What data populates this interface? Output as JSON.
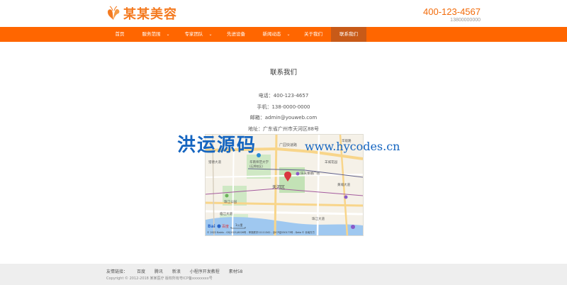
{
  "brand": {
    "name": "某某美容",
    "accent": "#ff6600",
    "nav_active": "#c85a18"
  },
  "header": {
    "phone": "400-123-4567",
    "mobile": "13800000000"
  },
  "nav": {
    "items": [
      {
        "label": "首页",
        "dropdown": false
      },
      {
        "label": "服务范围",
        "dropdown": true
      },
      {
        "label": "专家团队",
        "dropdown": true
      },
      {
        "label": "先进设备",
        "dropdown": false
      },
      {
        "label": "新闻动态",
        "dropdown": true
      },
      {
        "label": "关于我们",
        "dropdown": false
      },
      {
        "label": "联系我们",
        "dropdown": false,
        "active": true
      }
    ],
    "arrow": "⌄"
  },
  "contact": {
    "title": "联系我们",
    "phone": "电话：400-123-4657",
    "mobile": "手机：138-0000-0000",
    "email": "邮箱：admin@youweb.com",
    "address": "地址：广东省广州市天河区88号"
  },
  "map": {
    "labels": {
      "expressway": "广园快速路",
      "library": "华南师范大学",
      "library_sub": "(石牌校区)",
      "plaza": "乐天莱德广场",
      "district": "天河区",
      "park": "珠江公园",
      "avenue1": "临江大道",
      "avenue2": "珠江大道",
      "river_west": "猎德大道",
      "huangpu": "黄埔大道",
      "east_road": "华观路",
      "ling": "羊城花园"
    },
    "logo": "Bai",
    "logo_du": "百度",
    "scale": "1公里",
    "copyright": "© 2022 Baidu - GS(2021)6026号 - 甲测资字11111342 - 京ICP证030173号 - Data © 长地万方"
  },
  "watermark": {
    "cn": "洪运源码",
    "url": "www.hycodes.cn"
  },
  "footer": {
    "links_label": "友情链接：",
    "links": [
      "百度",
      "腾讯",
      "新浪",
      "小程序开发教程",
      "素材58"
    ],
    "copyright": "Copyright © 2012-2018 某某医疗 版权所有粤ICP备xxxxxxxx号"
  }
}
